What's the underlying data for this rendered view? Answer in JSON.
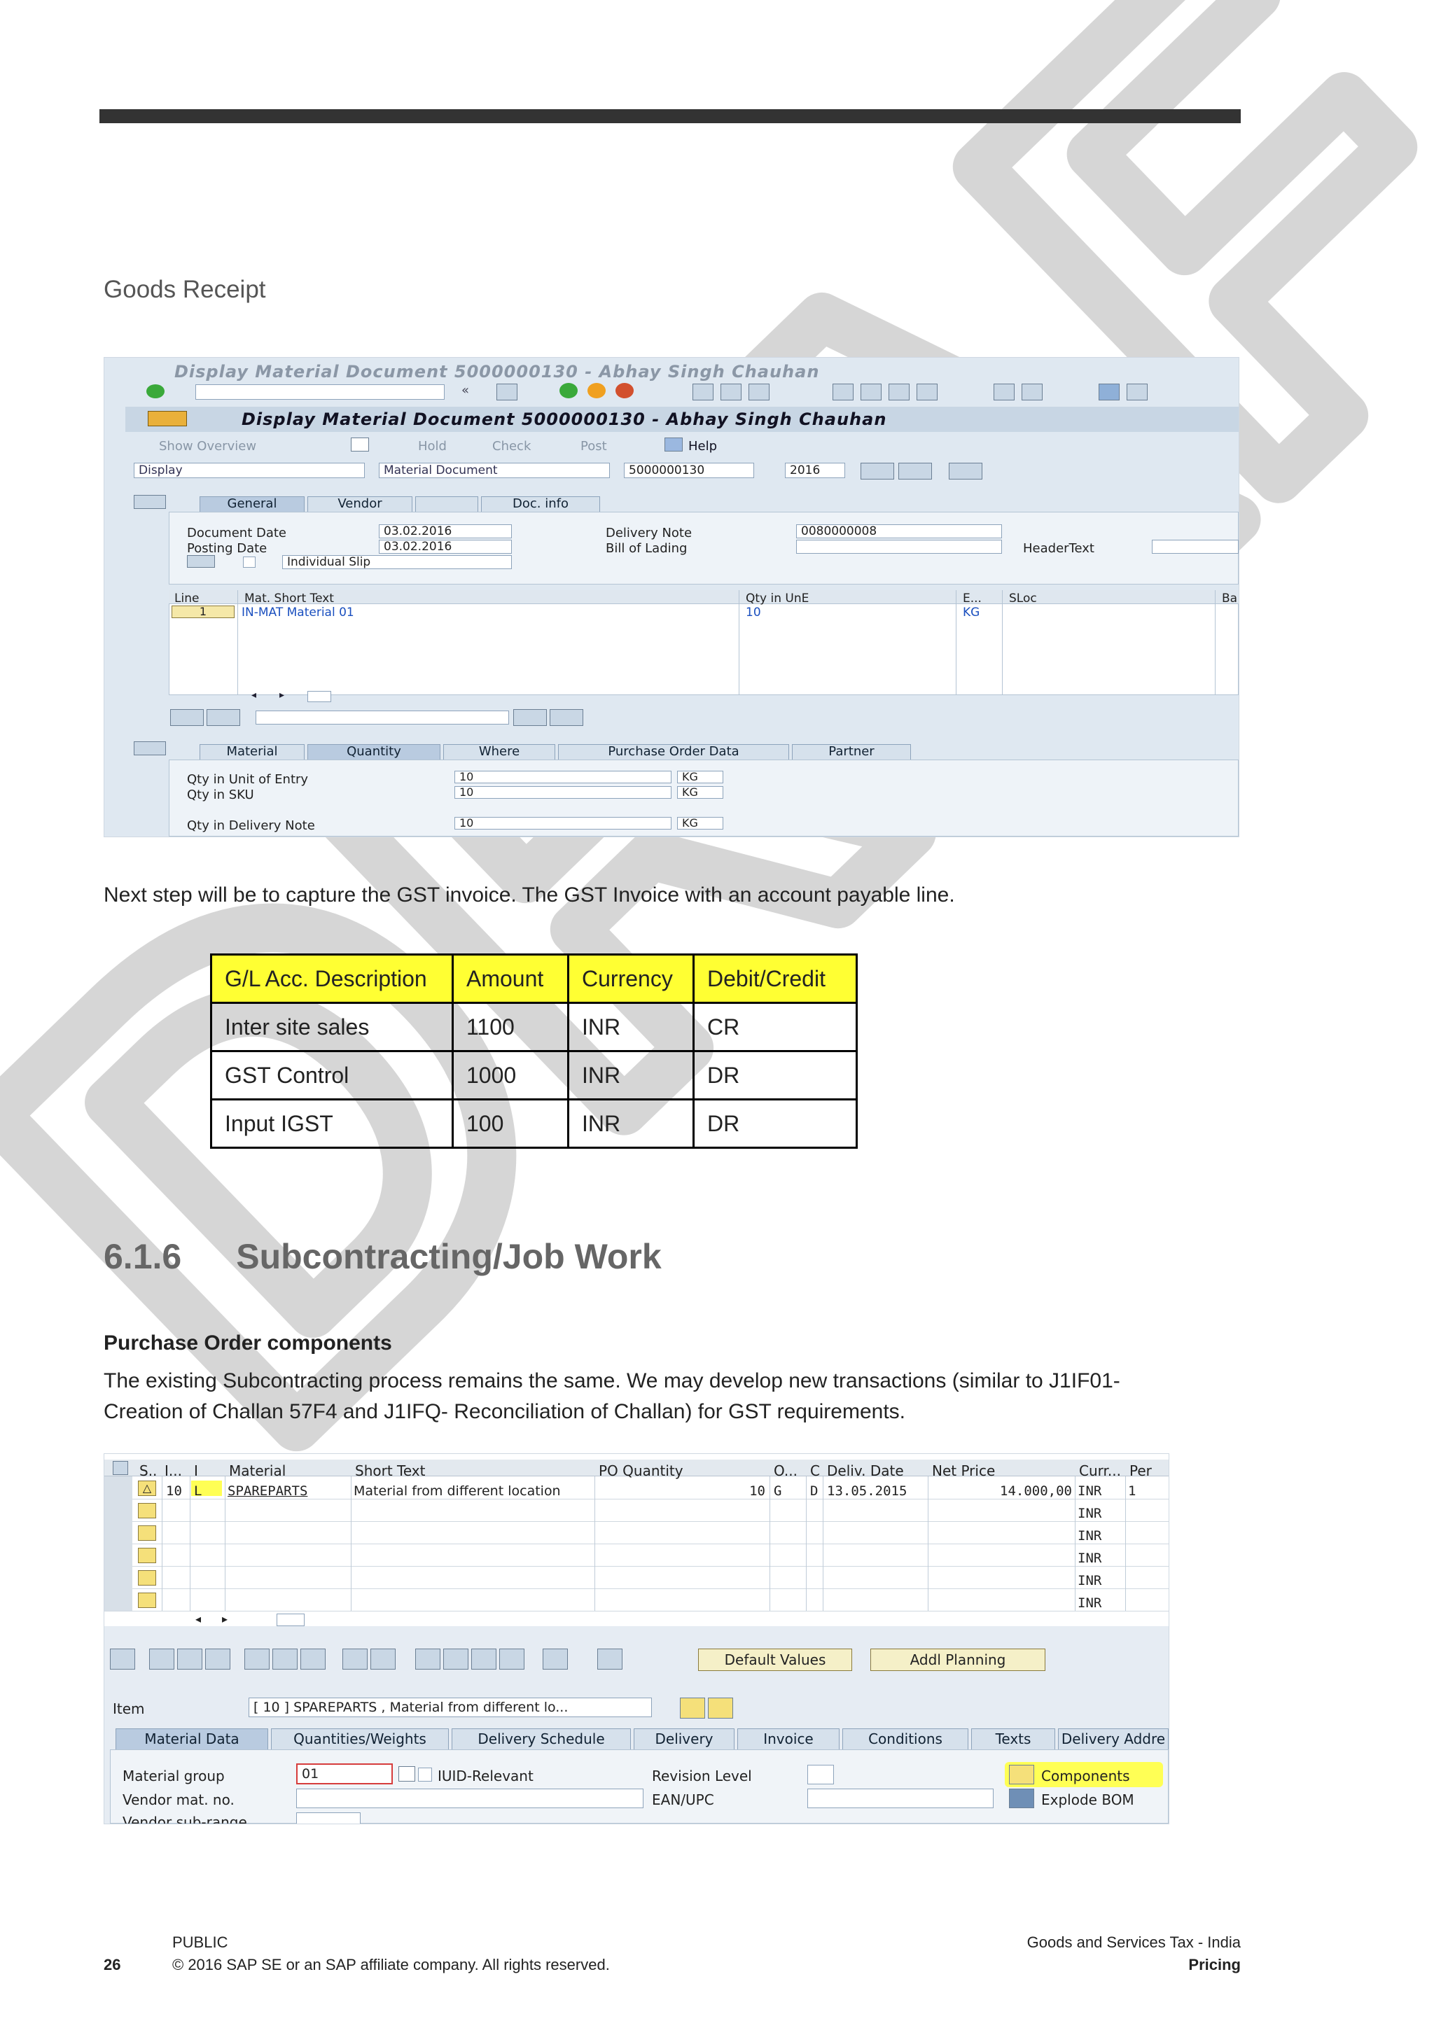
{
  "doc": {
    "section_heading": "Goods Receipt",
    "paragraph1": "Next step will be to capture the GST invoice. The GST Invoice with an account payable line.",
    "gl_table": {
      "headers": [
        "G/L Acc. Description",
        "Amount",
        "Currency",
        "Debit/Credit"
      ],
      "rows": [
        [
          "Inter site sales",
          "1100",
          "INR",
          "CR"
        ],
        [
          "GST Control",
          "1000",
          "INR",
          "DR"
        ],
        [
          "Input IGST",
          "100",
          "INR",
          "DR"
        ]
      ]
    },
    "section_number": "6.1.6",
    "section_title": "Subcontracting/Job Work",
    "subheading": "Purchase Order components",
    "paragraph2_line1": "The existing Subcontracting process remains the same. We may develop new transactions (similar to J1IF01-",
    "paragraph2_line2": "Creation of Challan 57F4 and J1IFQ- Reconciliation of Challan) for GST requirements.",
    "watermark": "DRAFT"
  },
  "screen1": {
    "window_title": "Display Material Document 5000000130 - Abhay Singh Chauhan",
    "inner_title": "Display Material Document 5000000130 - Abhay Singh Chauhan",
    "menu": [
      "Show Overview",
      "Hold",
      "Check",
      "Post",
      "Help"
    ],
    "mode": "Display",
    "doc_type": "Material Document",
    "doc_number": "5000000130",
    "year": "2016",
    "header_tabs": [
      "General",
      "Vendor",
      "Doc. info"
    ],
    "document_date_label": "Document Date",
    "document_date": "03.02.2016",
    "posting_date_label": "Posting Date",
    "posting_date": "03.02.2016",
    "slip": "Individual Slip",
    "delivery_note_label": "Delivery Note",
    "delivery_note": "0080000008",
    "bill_of_lading_label": "Bill of Lading",
    "header_text_label": "HeaderText",
    "grid_headers": [
      "Line",
      "Mat. Short Text",
      "Qty in UnE",
      "E...",
      "SLoc",
      "Ba"
    ],
    "grid_row": [
      "1",
      "IN-MAT Material 01",
      "10",
      "KG"
    ],
    "item_tabs": [
      "Material",
      "Quantity",
      "Where",
      "Purchase Order Data",
      "Partner"
    ],
    "qty_unit_entry_label": "Qty in Unit of Entry",
    "qty_unit_entry": "10",
    "qty_sku_label": "Qty in SKU",
    "qty_sku": "10",
    "qty_delivery_note_label": "Qty in Delivery Note",
    "qty_delivery_note": "10",
    "unit": "KG"
  },
  "screen2": {
    "grid_headers": [
      "S..",
      "I...",
      "I",
      "Material",
      "Short Text",
      "PO Quantity",
      "O...",
      "C",
      "Deliv. Date",
      "Net Price",
      "Curr...",
      "Per"
    ],
    "row": {
      "item": "10",
      "cat": "L",
      "material": "SPAREPARTS",
      "short_text": "Material from different location",
      "po_qty": "10",
      "unit": "G",
      "c": "D",
      "deliv_date": "13.05.2015",
      "net_price": "14.000,00",
      "curr": "INR",
      "per": "1"
    },
    "empty_curr": "INR",
    "default_values": "Default Values",
    "addl_planning": "Addl Planning",
    "item_label": "Item",
    "item_select": "[ 10 ] SPAREPARTS , Material from different lo...",
    "tabs": [
      "Material Data",
      "Quantities/Weights",
      "Delivery Schedule",
      "Delivery",
      "Invoice",
      "Conditions",
      "Texts",
      "Delivery Addre"
    ],
    "material_group_label": "Material group",
    "material_group": "01",
    "iuid_label": "IUID-Relevant",
    "revision_label": "Revision Level",
    "components": "Components",
    "vendor_mat_label": "Vendor mat. no.",
    "ean_label": "EAN/UPC",
    "explode_bom": "Explode BOM",
    "vendor_sub_label": "Vendor sub-range"
  },
  "footer": {
    "page_number": "26",
    "classification": "PUBLIC",
    "copyright": "© 2016 SAP SE or an SAP affiliate company. All rights reserved.",
    "doc_title": "Goods and Services Tax - India",
    "chapter": "Pricing"
  }
}
